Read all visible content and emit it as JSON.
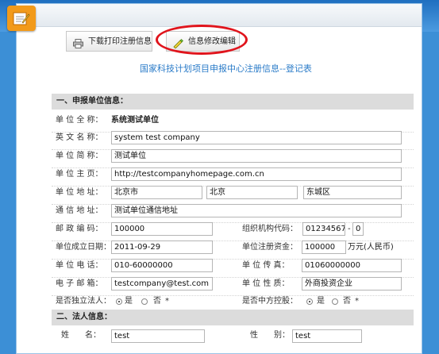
{
  "toolbar": {
    "download_label": "下载打印注册信息",
    "edit_label": "信息修改编辑"
  },
  "title": "国家科技计划项目申报中心注册信息--登记表",
  "section1": {
    "label": "一、申报单位信息："
  },
  "section2": {
    "label": "二、法人信息："
  },
  "unit": {
    "full_name_label": "单 位 全 称：",
    "full_name": "系统测试单位",
    "english_label": "英 文 名 称：",
    "english": "system test company",
    "short_label": "单 位 简 称：",
    "short": "测试单位",
    "homepage_label": "单 位 主 页：",
    "homepage": "http://testcompanyhomepage.com.cn",
    "address_label": "单 位 地 址：",
    "addr_city": "北京市",
    "addr_district": "北京",
    "addr_area": "东城区",
    "mail_addr_label": "通 信 地 址：",
    "mail_addr": "测试单位通信地址",
    "postcode_label": "邮 政 编 码：",
    "postcode": "100000",
    "org_code_label": "组织机构代码：",
    "org_code": "01234567",
    "org_code_dash": "-",
    "org_code_check": "0",
    "founded_label": "单位成立日期：",
    "founded": "2011-09-29",
    "capital_label": "单位注册资金：",
    "capital": "100000",
    "capital_unit": "万元(人民币)",
    "phone_label": "单 位 电 话：",
    "phone": "010-60000000",
    "fax_label": "单 位 传 真：",
    "fax": "01060000000",
    "email_label": "电 子 邮 箱：",
    "email": "testcompany@test.com",
    "nature_label": "单 位 性 质：",
    "nature": "外商投资企业",
    "independent_label": "是否独立法人：",
    "yes": "是",
    "no": "否",
    "required_mark": "*",
    "china_control_label": "是否中方控股："
  },
  "legal": {
    "name_label": "姓　　名：",
    "name": "test",
    "gender_label": "性　　别：",
    "gender": "test"
  }
}
